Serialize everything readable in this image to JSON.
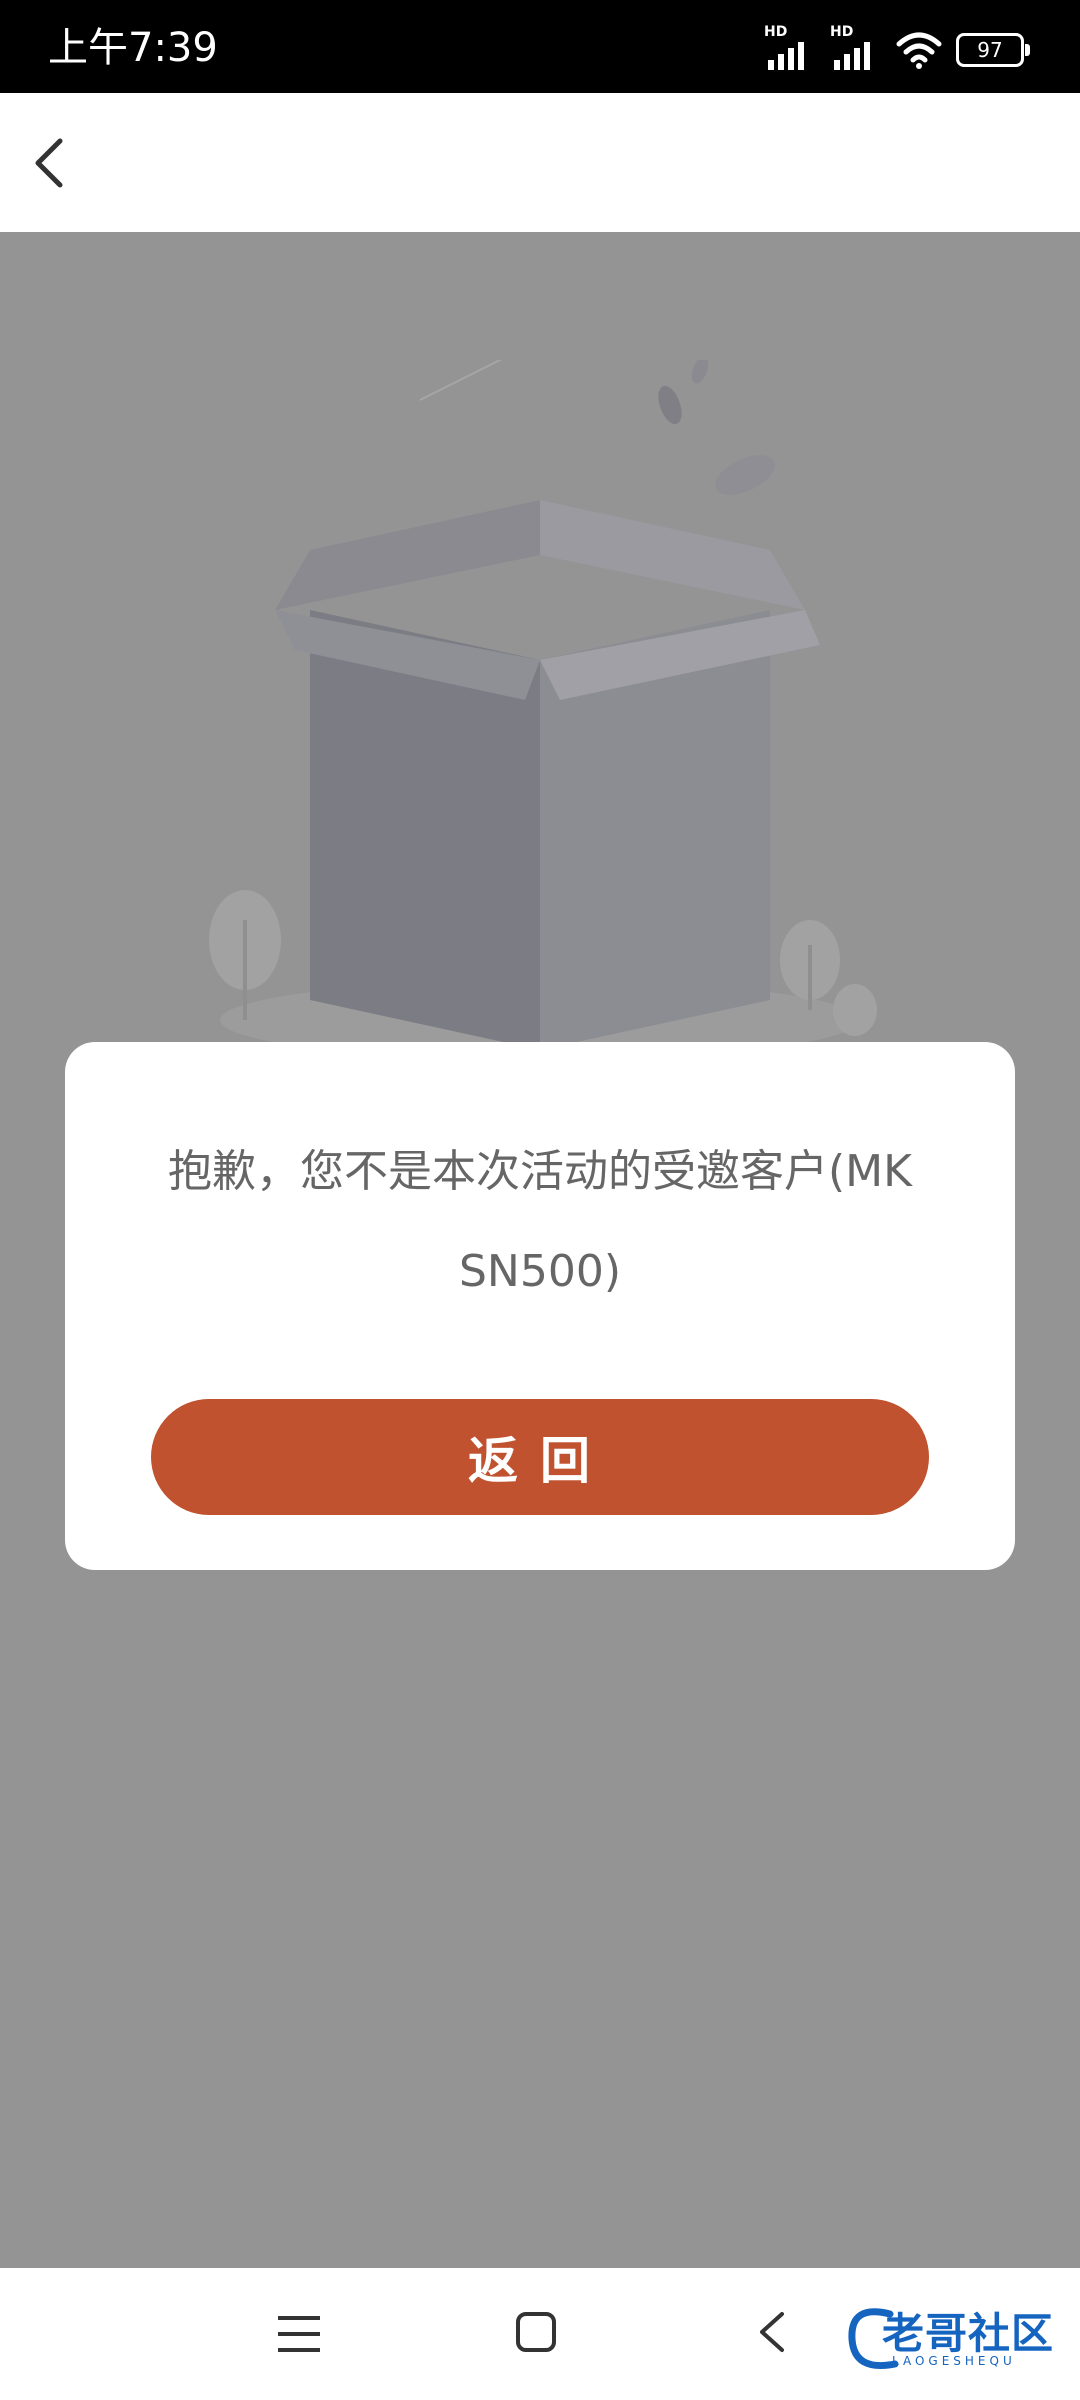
{
  "status_bar": {
    "time": "上午7:39",
    "signal1_label": "HD",
    "signal2_label": "HD",
    "battery": "97",
    "icons": [
      "signal-icon",
      "signal-icon",
      "wifi-icon",
      "battery-icon"
    ]
  },
  "app_bar": {
    "back_icon": "chevron-left-icon"
  },
  "dialog": {
    "message": "抱歉，您不是本次活动的受邀客户(MKSN500)",
    "button_label": "返回"
  },
  "nav_bar": {
    "icons": [
      "menu-icon",
      "home-icon",
      "back-icon"
    ]
  },
  "watermark": {
    "text": "老哥社区",
    "subtext": "LAOGESHEQU"
  },
  "colors": {
    "status_bar_bg": "#000000",
    "overlay_bg": "#949494",
    "accent": "#c0522f",
    "dialog_text": "#666666",
    "watermark": "#1565c0"
  }
}
